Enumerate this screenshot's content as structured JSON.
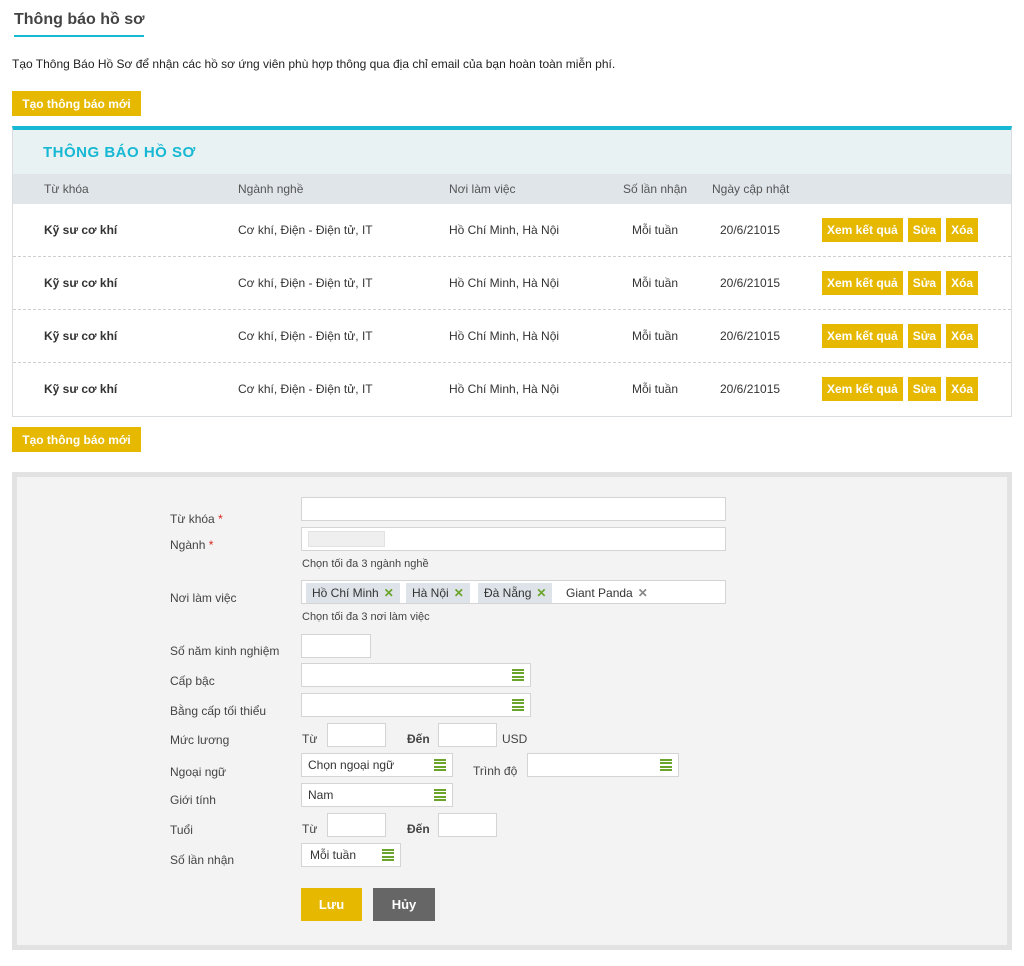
{
  "page": {
    "title": "Thông báo hồ sơ",
    "intro": "Tạo Thông Báo Hồ Sơ để nhận các hồ sơ ứng viên phù hợp thông qua địa chỉ email của bạn hoàn toàn miễn phí.",
    "create_label": "Tạo thông báo mới"
  },
  "alerts": {
    "title": "THÔNG BÁO HỒ SƠ",
    "columns": [
      "Từ khóa",
      "Ngành nghề",
      "Nơi làm việc",
      "Số lần nhận",
      "Ngày cập nhật"
    ],
    "rows": [
      {
        "keyword": "Kỹ sư cơ khí",
        "industry": "Cơ khí, Điện - Điện tử, IT",
        "location": "Hồ Chí Minh, Hà Nội",
        "frequency": "Mỗi tuần",
        "updated": "20/6/21015"
      },
      {
        "keyword": "Kỹ sư cơ khí",
        "industry": "Cơ khí, Điện - Điện tử, IT",
        "location": "Hồ Chí Minh, Hà Nội",
        "frequency": "Mỗi tuần",
        "updated": "20/6/21015"
      },
      {
        "keyword": "Kỹ sư cơ khí",
        "industry": "Cơ khí, Điện - Điện tử, IT",
        "location": "Hồ Chí Minh, Hà Nội",
        "frequency": "Mỗi tuần",
        "updated": "20/6/21015"
      },
      {
        "keyword": "Kỹ sư cơ khí",
        "industry": "Cơ khí, Điện - Điện tử, IT",
        "location": "Hồ Chí Minh, Hà Nội",
        "frequency": "Mỗi tuần",
        "updated": "20/6/21015"
      }
    ],
    "actions": {
      "view": "Xem kết quả",
      "edit": "Sửa",
      "delete": "Xóa"
    }
  },
  "form": {
    "keyword_label": "Từ khóa",
    "industry_label": "Ngành",
    "industry_hint": "Chọn tối đa 3 ngành nghề",
    "location_label": "Nơi làm việc",
    "location_tags": [
      "Hồ Chí Minh",
      "Hà Nội",
      "Đà Nẵng",
      "Giant Panda"
    ],
    "location_hint": "Chọn tối đa 3 nơi làm việc",
    "experience_label": "Số năm kinh nghiệm",
    "level_label": "Cấp bậc",
    "degree_label": "Bằng cấp tối thiểu",
    "salary_label": "Mức lương",
    "from_label": "Từ",
    "to_label": "Đến",
    "currency": "USD",
    "language_label": "Ngoại ngữ",
    "language_value": "Chọn ngoại ngữ",
    "proficiency_label": "Trình độ",
    "gender_label": "Giới tính",
    "gender_value": "Nam",
    "age_label": "Tuổi",
    "frequency_label": "Số lần nhận",
    "frequency_value": "Mỗi tuần",
    "save_label": "Lưu",
    "cancel_label": "Hủy",
    "required_mark": "*"
  },
  "colors": {
    "accent": "#16b8d3",
    "button": "#e6b800",
    "icon_green": "#6aa42b",
    "cancel": "#666666"
  }
}
